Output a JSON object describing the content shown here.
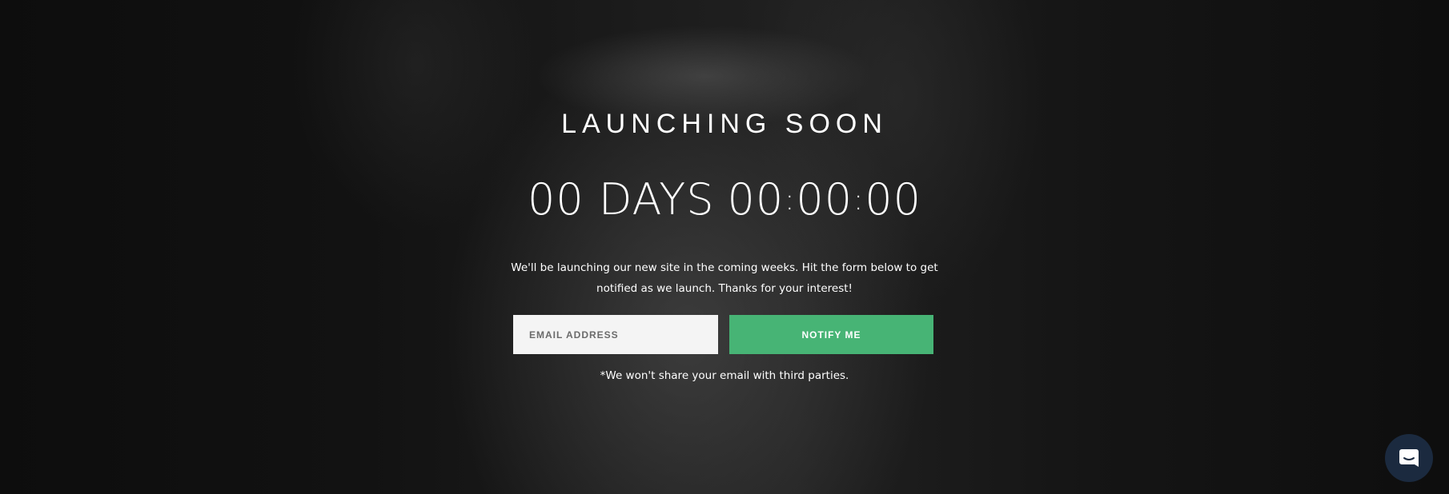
{
  "hero": {
    "title": "LAUNCHING SOON",
    "countdown": {
      "days": "00",
      "days_label": "DAYS",
      "hours": "00",
      "minutes": "00",
      "seconds": "00",
      "separator": ":"
    },
    "description": "We'll be launching our new site in the coming weeks. Hit the form below to get notified as we launch. Thanks for your interest!"
  },
  "form": {
    "email_placeholder": "EMAIL ADDRESS",
    "email_value": "",
    "notify_label": "NOTIFY ME",
    "disclaimer": "*We won't share your email with third parties."
  },
  "chat": {
    "icon": "chat-bubble-icon"
  },
  "colors": {
    "accent": "#47b475",
    "chat_background": "#1b2a3f",
    "input_background": "#f4f4f4"
  }
}
